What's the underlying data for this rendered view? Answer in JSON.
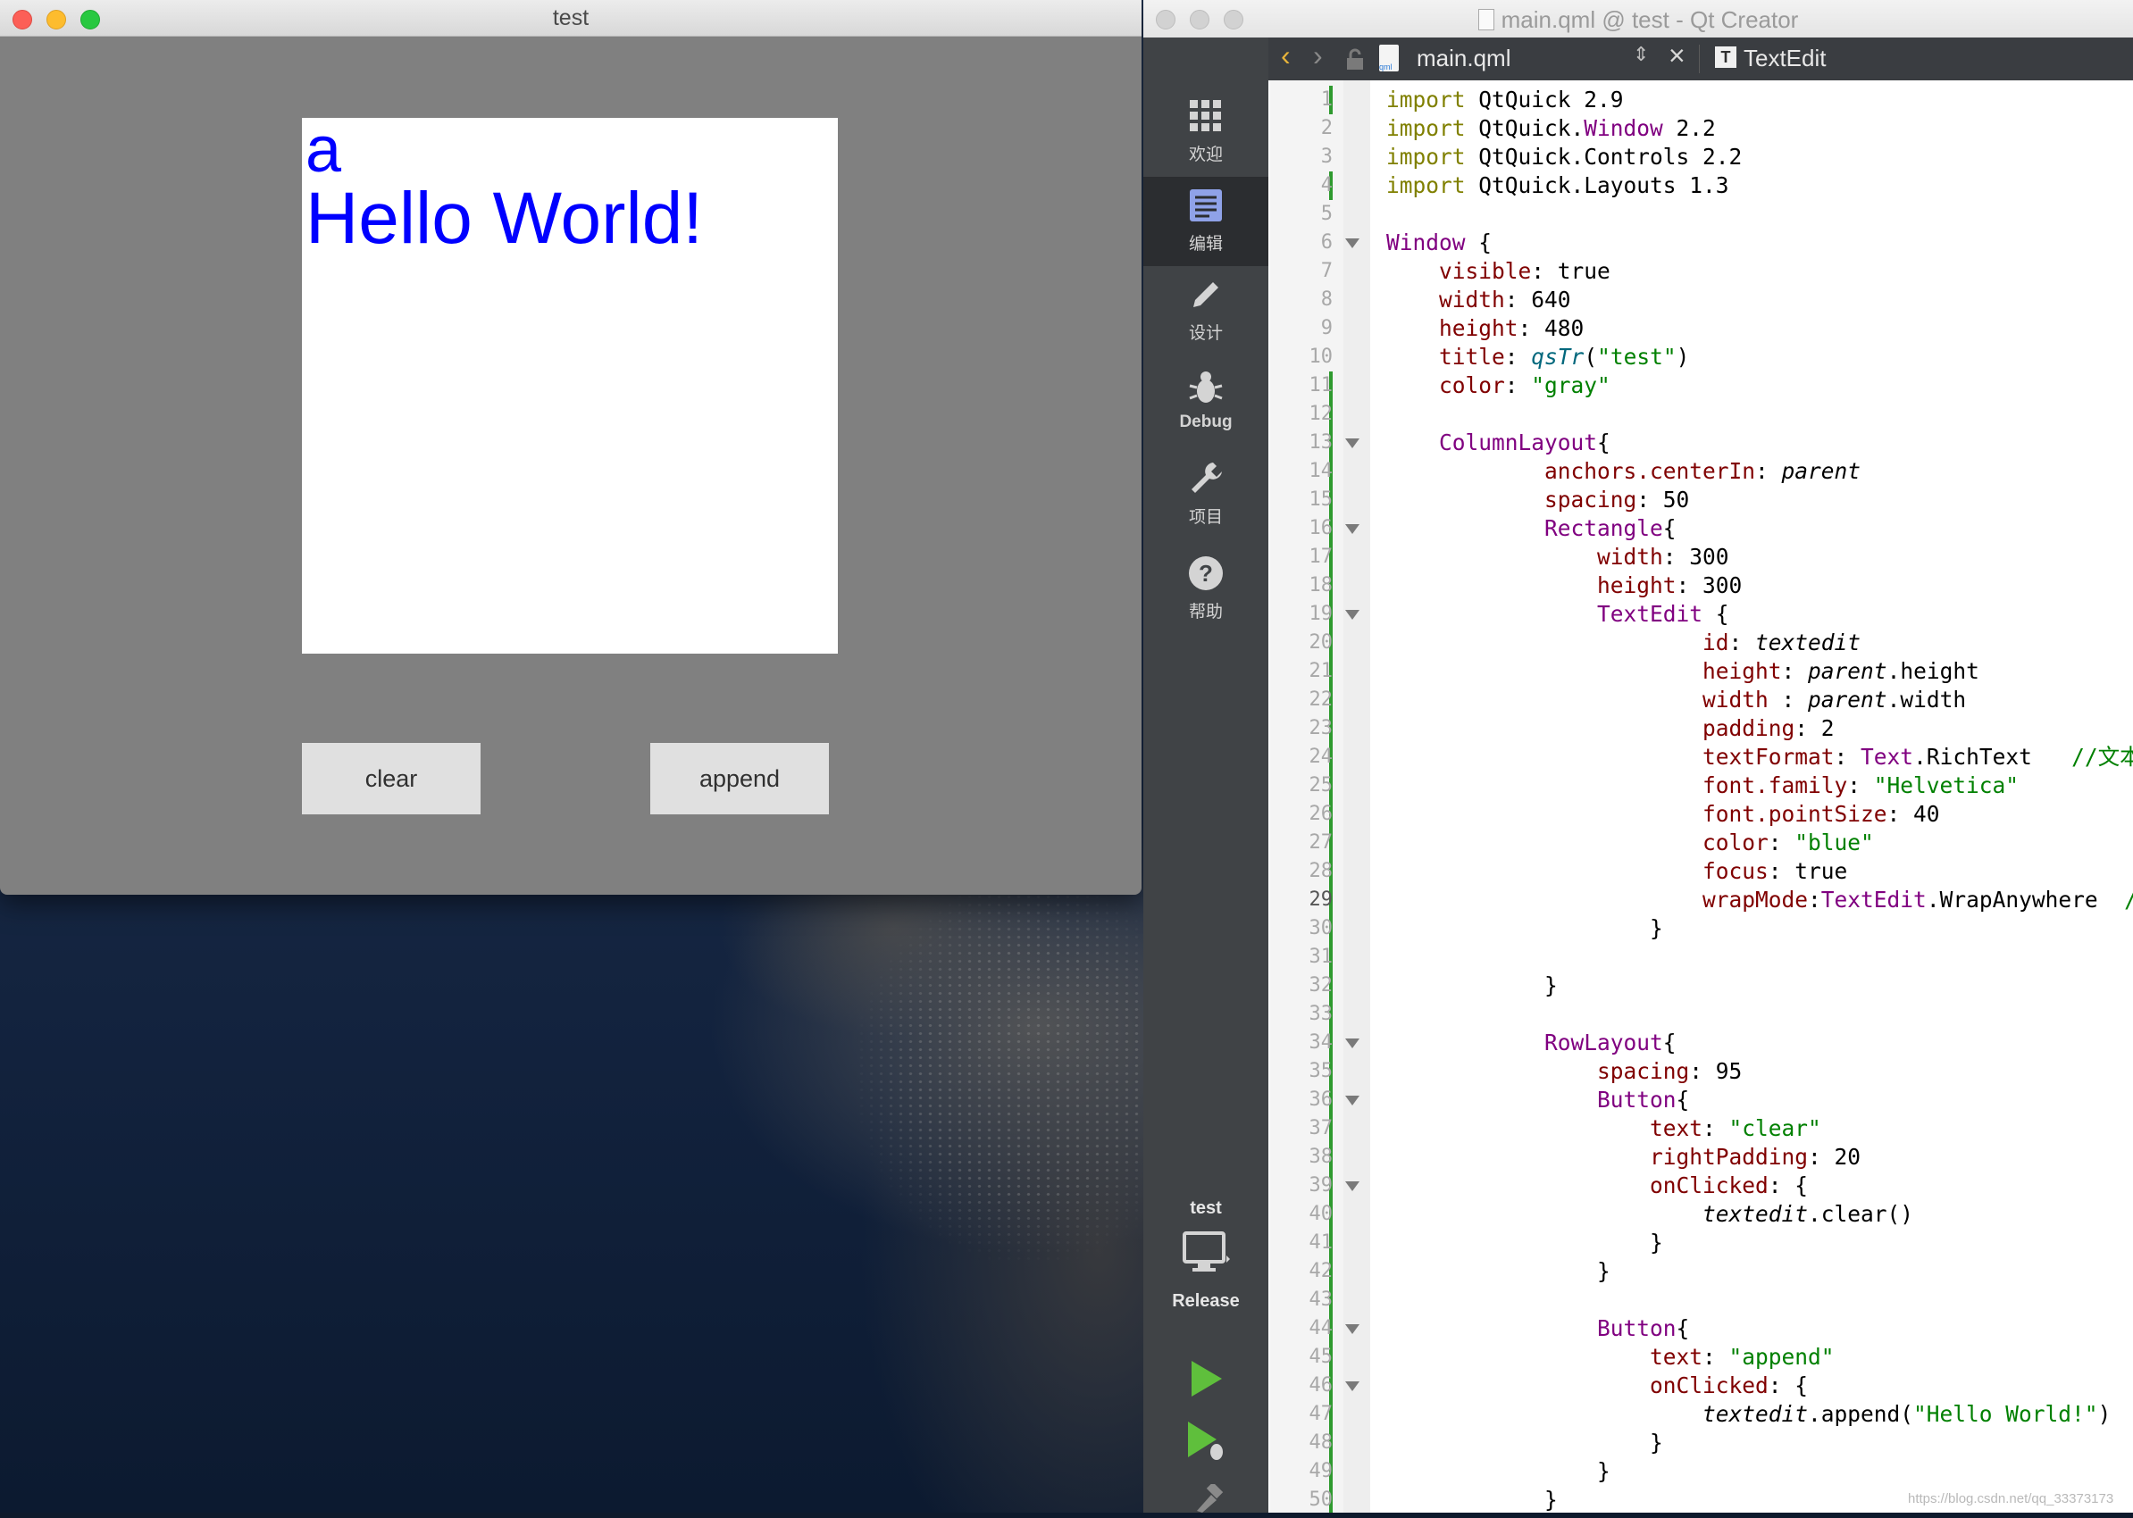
{
  "app_window": {
    "title": "test",
    "text_lines": [
      "a",
      "Hello World!"
    ],
    "buttons": {
      "clear": "clear",
      "append": "append"
    },
    "background": "#808080",
    "text_color": "#0000ff"
  },
  "qt_creator": {
    "title": "main.qml @ test - Qt Creator",
    "toolbar": {
      "file_name": "main.qml",
      "symbol": "TextEdit",
      "back_icon": "chevron-left-icon",
      "forward_icon": "chevron-right-icon",
      "lock_icon": "lock-icon",
      "close_icon": "close-icon"
    },
    "modes": [
      {
        "label": "欢迎",
        "icon": "grid-icon"
      },
      {
        "label": "编辑",
        "icon": "edit-document-icon"
      },
      {
        "label": "设计",
        "icon": "pencil-icon"
      },
      {
        "label": "Debug",
        "icon": "bug-icon"
      },
      {
        "label": "项目",
        "icon": "wrench-icon"
      },
      {
        "label": "帮助",
        "icon": "help-icon"
      }
    ],
    "target": {
      "project": "test",
      "config": "Release"
    },
    "current_line": 29
  },
  "code_lines": [
    {
      "n": "1",
      "text": "import QtQuick 2.9"
    },
    {
      "n": "2",
      "text": "import QtQuick.Window 2.2"
    },
    {
      "n": "3",
      "text": "import QtQuick.Controls 2.2"
    },
    {
      "n": "4",
      "text": "import QtQuick.Layouts 1.3"
    },
    {
      "n": "5",
      "text": ""
    },
    {
      "n": "6",
      "text": "Window {"
    },
    {
      "n": "7",
      "text": "    visible: true"
    },
    {
      "n": "8",
      "text": "    width: 640"
    },
    {
      "n": "9",
      "text": "    height: 480"
    },
    {
      "n": "10",
      "text": "    title: qsTr(\"test\")"
    },
    {
      "n": "11",
      "text": "    color: \"gray\""
    },
    {
      "n": "12",
      "text": ""
    },
    {
      "n": "13",
      "text": "    ColumnLayout{"
    },
    {
      "n": "14",
      "text": "            anchors.centerIn: parent"
    },
    {
      "n": "15",
      "text": "            spacing: 50"
    },
    {
      "n": "16",
      "text": "            Rectangle{"
    },
    {
      "n": "17",
      "text": "                width: 300"
    },
    {
      "n": "18",
      "text": "                height: 300"
    },
    {
      "n": "19",
      "text": "                TextEdit {"
    },
    {
      "n": "20",
      "text": "                        id: textedit"
    },
    {
      "n": "21",
      "text": "                        height: parent.height"
    },
    {
      "n": "22",
      "text": "                        width : parent.width"
    },
    {
      "n": "23",
      "text": "                        padding: 2"
    },
    {
      "n": "24",
      "text": "                        textFormat: Text.RichText   //文本显"
    },
    {
      "n": "25",
      "text": "                        font.family: \"Helvetica\""
    },
    {
      "n": "26",
      "text": "                        font.pointSize: 40"
    },
    {
      "n": "27",
      "text": "                        color: \"blue\""
    },
    {
      "n": "28",
      "text": "                        focus: true"
    },
    {
      "n": "29",
      "text": "                        wrapMode:TextEdit.WrapAnywhere  //决"
    },
    {
      "n": "30",
      "text": "                    }"
    },
    {
      "n": "31",
      "text": ""
    },
    {
      "n": "32",
      "text": "            }"
    },
    {
      "n": "33",
      "text": ""
    },
    {
      "n": "34",
      "text": "            RowLayout{"
    },
    {
      "n": "35",
      "text": "                spacing: 95"
    },
    {
      "n": "36",
      "text": "                Button{"
    },
    {
      "n": "37",
      "text": "                    text: \"clear\""
    },
    {
      "n": "38",
      "text": "                    rightPadding: 20"
    },
    {
      "n": "39",
      "text": "                    onClicked: {"
    },
    {
      "n": "40",
      "text": "                        textedit.clear()"
    },
    {
      "n": "41",
      "text": "                    }"
    },
    {
      "n": "42",
      "text": "                }"
    },
    {
      "n": "43",
      "text": ""
    },
    {
      "n": "44",
      "text": "                Button{"
    },
    {
      "n": "45",
      "text": "                    text: \"append\""
    },
    {
      "n": "46",
      "text": "                    onClicked: {"
    },
    {
      "n": "47",
      "text": "                        textedit.append(\"Hello World!\")"
    },
    {
      "n": "48",
      "text": "                    }"
    },
    {
      "n": "49",
      "text": "                }"
    },
    {
      "n": "50",
      "text": "            }"
    }
  ],
  "fold_lines": [
    6,
    13,
    16,
    19,
    34,
    36,
    39,
    44,
    46
  ],
  "watermark": "https://blog.csdn.net/qq_33373173"
}
